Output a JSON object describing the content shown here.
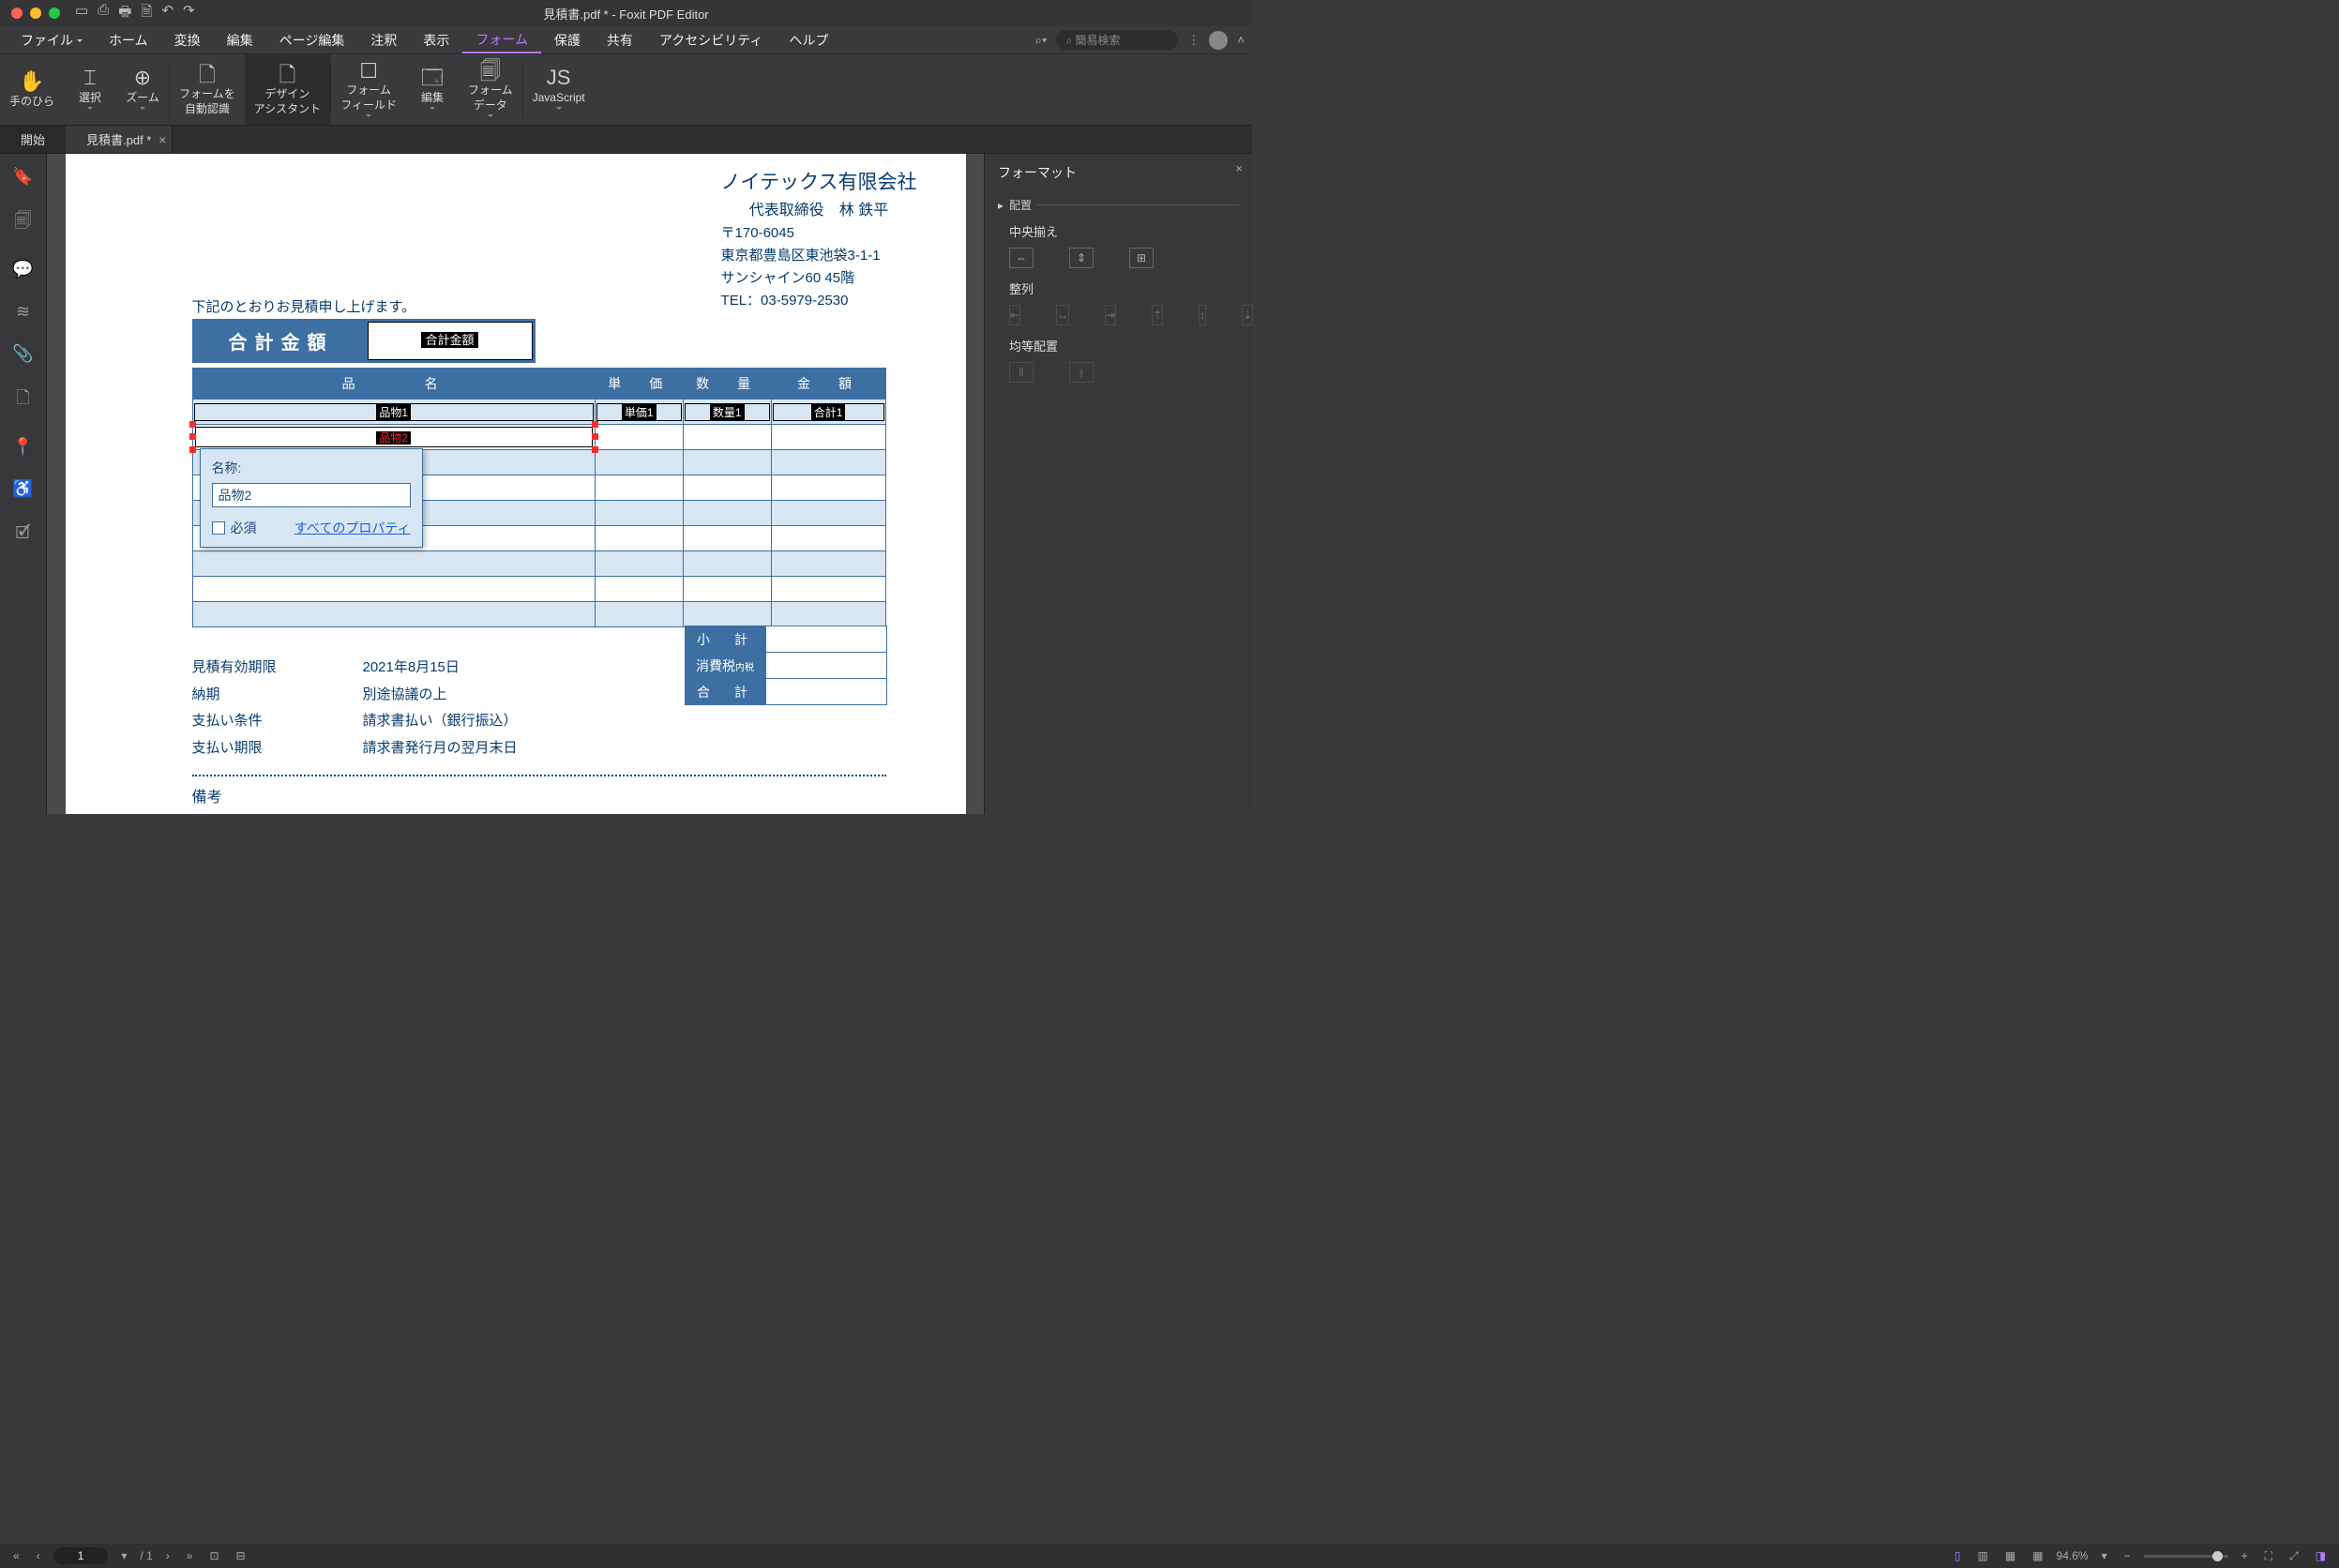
{
  "titlebar": {
    "title": "見積書.pdf * - Foxit PDF Editor"
  },
  "menu": {
    "file": "ファイル",
    "home": "ホーム",
    "convert": "変換",
    "edit": "編集",
    "page": "ページ編集",
    "annot": "注釈",
    "view": "表示",
    "form": "フォーム",
    "protect": "保護",
    "share": "共有",
    "access": "アクセシビリティ",
    "help": "ヘルプ",
    "search_ph": "簡易検索"
  },
  "ribbon": {
    "hand": "手のひら",
    "select": "選択",
    "zoom": "ズーム",
    "auto": "フォームを\n自動認識",
    "design": "デザイン\nアシスタント",
    "field": "フォーム\nフィールド",
    "edit": "編集",
    "data": "フォーム\nデータ",
    "js": "JavaScript"
  },
  "tabs": {
    "start": "開始",
    "file": "見積書.pdf *"
  },
  "rightpanel": {
    "title": "フォーマット",
    "sec_arrange": "配置",
    "center": "中央揃え",
    "align": "整列",
    "distribute": "均等配置"
  },
  "doc": {
    "company": "ノイテックス有限会社",
    "rep": "代表取締役　林 鉄平",
    "zip": "〒170-6045",
    "addr": "東京都豊島区東池袋3-1-1",
    "bldg": "サンシャイン60 45階",
    "tel": "TEL：03-5979-2530",
    "intro": "下記のとおりお見積申し上げます。",
    "total_label": "合計金額",
    "total_field": "合計金額",
    "th_item": "品　　　名",
    "th_price": "単　価",
    "th_qty": "数　量",
    "th_amount": "金　額",
    "f_item1": "品物1",
    "f_price1": "単価1",
    "f_qty1": "数量1",
    "f_amount1": "合計1",
    "f_item2": "品物2",
    "sub": "小　計",
    "tax": "消費税",
    "tax_note": "内税",
    "grand": "合　計",
    "meta": {
      "l1": "見積有効期限",
      "v1": "2021年8月15日",
      "l2": "納期",
      "v2": "別途協議の上",
      "l3": "支払い条件",
      "v3": "請求書払い（銀行振込）",
      "l4": "支払い期限",
      "v4": "請求書発行月の翌月末日"
    },
    "remarks": "備考"
  },
  "popup": {
    "name_label": "名称:",
    "name_value": "品物2",
    "required": "必須",
    "allprops": "すべてのプロパティ"
  },
  "status": {
    "page": "1",
    "pages": "/ 1",
    "zoom": "94.6%"
  }
}
